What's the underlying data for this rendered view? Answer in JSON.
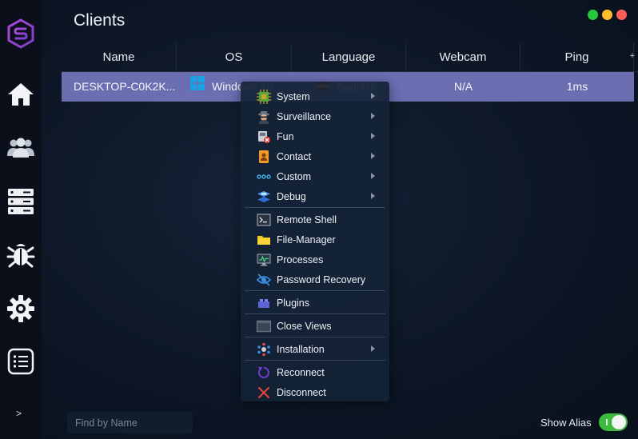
{
  "app": {
    "title": "Clients"
  },
  "window_controls": {
    "colors": {
      "maximize": "#27c93f",
      "minimize": "#ffbd2e",
      "close": "#ff5f56"
    }
  },
  "sidebar": {
    "icons": [
      "logo-icon",
      "home-icon",
      "users-icon",
      "servers-icon",
      "bug-icon",
      "gear-icon",
      "list-icon"
    ],
    "expand_label": ">"
  },
  "table": {
    "columns": [
      "Name",
      "OS",
      "Language",
      "Webcam",
      "Ping"
    ],
    "add_column_label": "+",
    "rows": [
      {
        "name": "DESKTOP-C0K2K...",
        "os": "Windows 10",
        "language": "Spanish",
        "webcam": "N/A",
        "ping": "1ms"
      }
    ]
  },
  "context_menu": {
    "groups": [
      [
        {
          "label": "System",
          "icon": "chip-icon",
          "submenu": true
        },
        {
          "label": "Surveillance",
          "icon": "spy-icon",
          "submenu": true
        },
        {
          "label": "Fun",
          "icon": "fun-icon",
          "submenu": true
        },
        {
          "label": "Contact",
          "icon": "contact-book-icon",
          "submenu": true
        },
        {
          "label": "Custom",
          "icon": "dots-icon",
          "submenu": true
        },
        {
          "label": "Debug",
          "icon": "layers-icon",
          "submenu": true
        }
      ],
      [
        {
          "label": "Remote Shell",
          "icon": "terminal-icon",
          "submenu": false
        },
        {
          "label": "File-Manager",
          "icon": "folder-icon",
          "submenu": false
        },
        {
          "label": "Processes",
          "icon": "monitor-icon",
          "submenu": false
        },
        {
          "label": "Password Recovery",
          "icon": "eye-recovery-icon",
          "submenu": false
        }
      ],
      [
        {
          "label": "Plugins",
          "icon": "plugin-icon",
          "submenu": false
        }
      ],
      [
        {
          "label": "Close Views",
          "icon": "window-icon",
          "submenu": false
        }
      ],
      [
        {
          "label": "Installation",
          "icon": "installation-icon",
          "submenu": true
        }
      ],
      [
        {
          "label": "Reconnect",
          "icon": "reconnect-icon",
          "submenu": false
        },
        {
          "label": "Disconnect",
          "icon": "x-icon",
          "submenu": false
        }
      ]
    ]
  },
  "footer": {
    "search_placeholder": "Find by Name",
    "alias_label": "Show Alias",
    "show_alias_on": true
  },
  "colors": {
    "accent_row": "#6b6fb2",
    "toggle_on": "#3dbb3f",
    "sidebar_bg": "#0a0f1a"
  }
}
